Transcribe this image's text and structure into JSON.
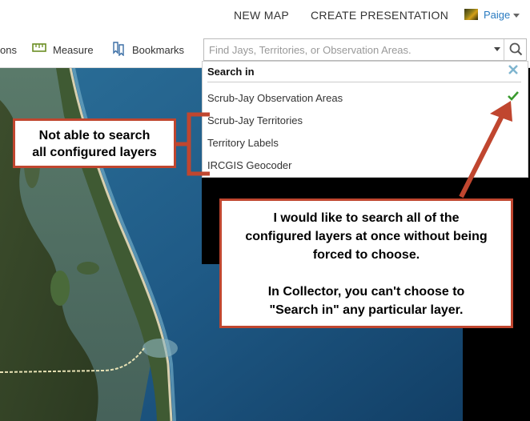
{
  "nav": {
    "new_map": "NEW MAP",
    "create_presentation": "CREATE PRESENTATION",
    "user": "Paige"
  },
  "toolbar": {
    "partial_label": "ons",
    "measure_label": "Measure",
    "bookmarks_label": "Bookmarks",
    "search_placeholder": "Find Jays, Territories, or Observation Areas."
  },
  "search_menu": {
    "header": "Search in",
    "items": [
      {
        "label": "Scrub-Jay Observation Areas",
        "selected": true
      },
      {
        "label": "Scrub-Jay Territories",
        "selected": false
      },
      {
        "label": "Territory Labels",
        "selected": false
      },
      {
        "label": "IRCGIS Geocoder",
        "selected": false
      }
    ]
  },
  "annotations": {
    "left": [
      "Not able to search",
      "all configured layers"
    ],
    "right": [
      "I would like to search all of the",
      "configured layers at once without being",
      "forced to choose.",
      "",
      "In Collector, you can't choose to",
      "\"Search in\" any particular layer."
    ]
  },
  "colors": {
    "accent": "#c0462f",
    "link": "#2a7bc1",
    "check": "#3a9a2e"
  },
  "icons": [
    "measure-icon",
    "bookmarks-icon",
    "search-icon",
    "close-icon",
    "checkmark-icon"
  ]
}
